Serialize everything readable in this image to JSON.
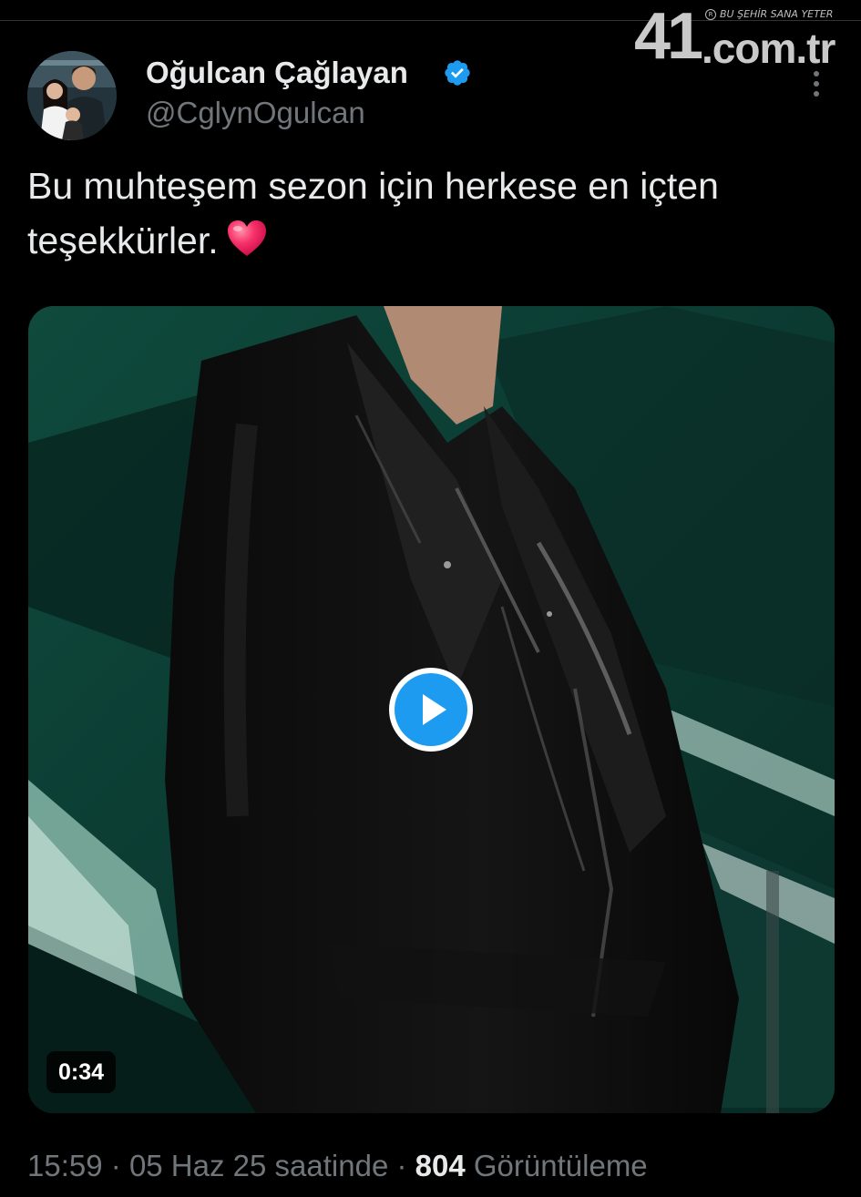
{
  "watermark": {
    "number": "41",
    "domain": ".com.tr",
    "slogan": "BU ŞEHİR SANA YETER",
    "registered_mark": "R"
  },
  "tweet": {
    "author": {
      "display_name": "Oğulcan Çağlayan",
      "handle": "@CglynOgulcan",
      "verified": true,
      "avatar_icon": "profile-photo"
    },
    "text_lines": [
      "Bu muhteşem sezon için herkese en içten",
      "teşekkürler."
    ],
    "emoji": "red-heart",
    "media": {
      "type": "video",
      "duration": "0:34",
      "play_icon": "play-icon"
    },
    "time": "15:59",
    "separator": "·",
    "date": "05 Haz 25 saatinde",
    "views_count": "804",
    "views_label": "Görüntüleme"
  },
  "colors": {
    "background": "#000000",
    "text_primary": "#e7e9ea",
    "text_secondary": "#71767b",
    "verified_blue": "#1d9bf0",
    "play_blue": "#1d9bf0",
    "heart_red": "#f91880"
  }
}
